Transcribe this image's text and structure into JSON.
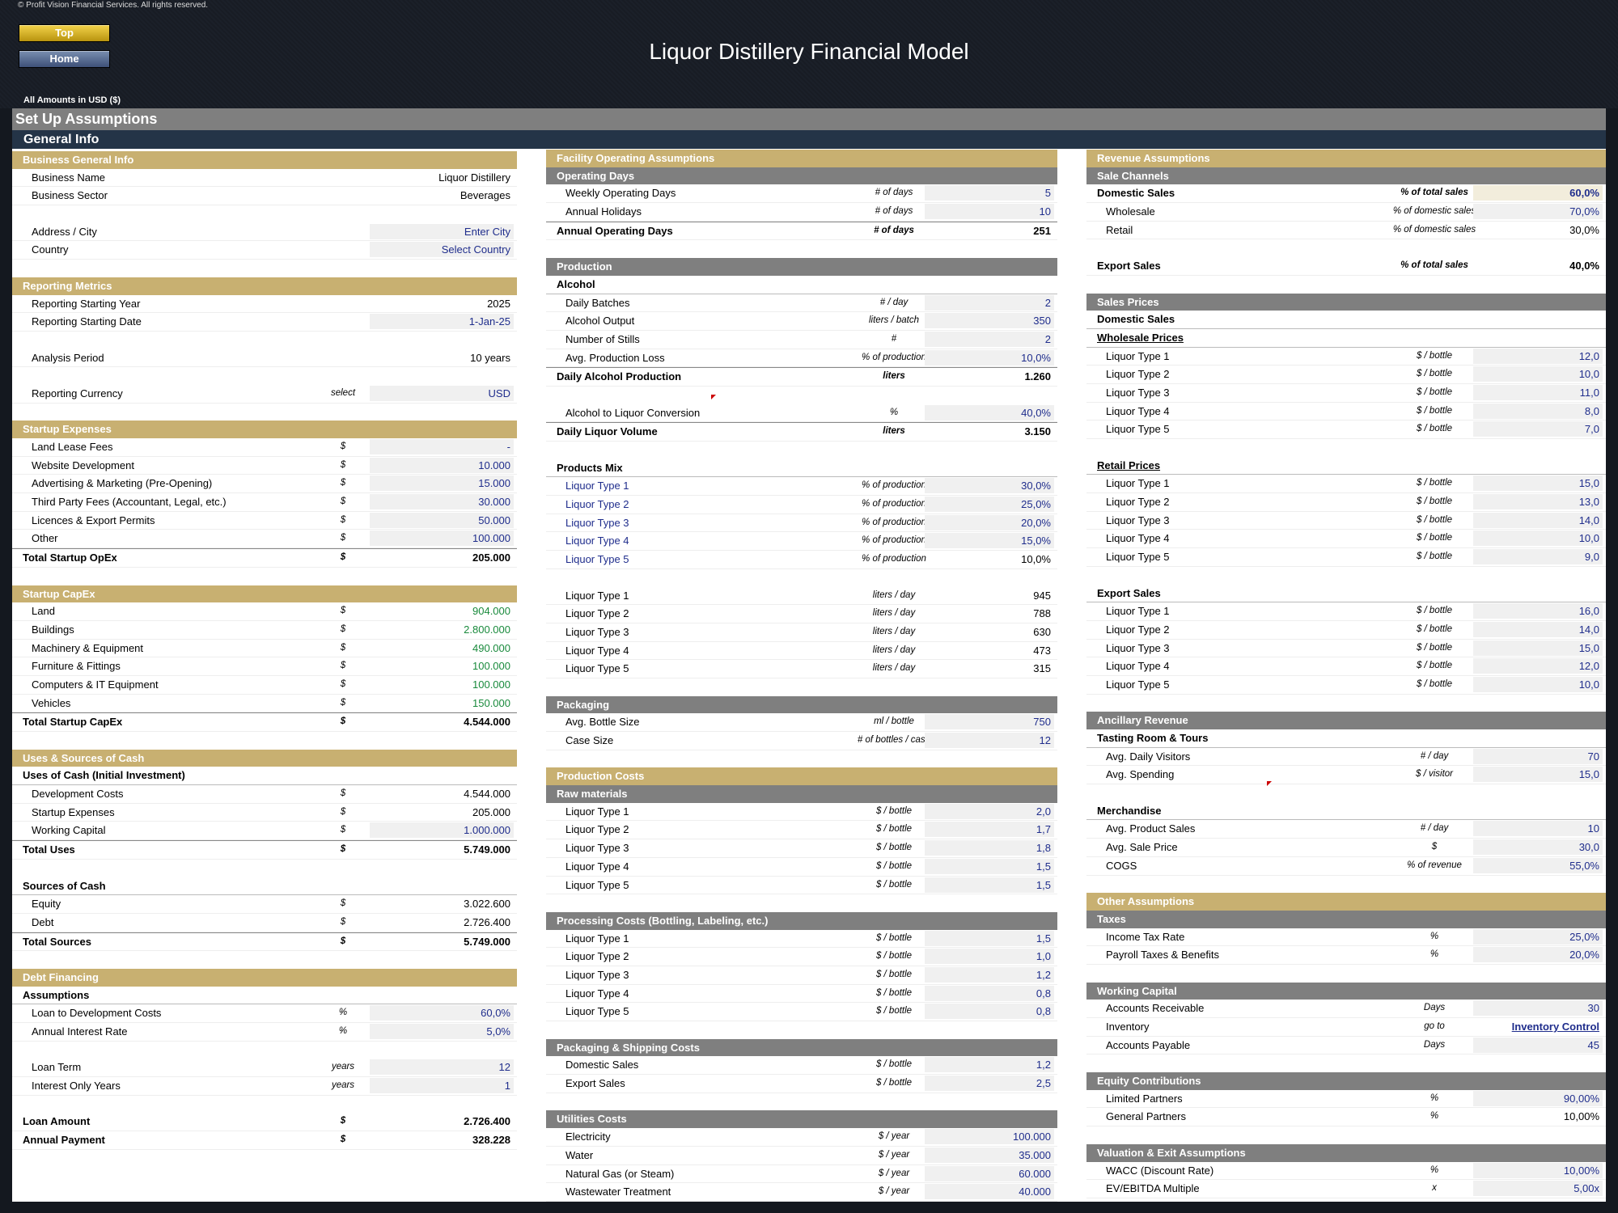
{
  "header": {
    "copyright": "© Profit Vision Financial Services. All rights reserved.",
    "top_button": "Top",
    "home_button": "Home",
    "title": "Liquor Distillery Financial Model",
    "amounts": "All Amounts in  USD ($)",
    "section": "Set Up Assumptions",
    "subsection": "General Info"
  },
  "col1": [
    {
      "t": "hdr",
      "label": "Business General Info"
    },
    {
      "t": "item",
      "label": "Business Name",
      "val": "Liquor Distillery",
      "style": "blk"
    },
    {
      "t": "item",
      "label": "Business Sector",
      "val": "Beverages",
      "style": "blk"
    },
    {
      "t": "sp"
    },
    {
      "t": "item",
      "label": "Address / City",
      "val": "Enter City",
      "style": "inp"
    },
    {
      "t": "item",
      "label": "Country",
      "val": "Select Country",
      "style": "inp"
    },
    {
      "t": "sp"
    },
    {
      "t": "hdr",
      "label": "Reporting Metrics"
    },
    {
      "t": "item",
      "label": "Reporting Starting Year",
      "val": "2025",
      "style": "blk"
    },
    {
      "t": "item",
      "label": "Reporting Starting Date",
      "val": "1-Jan-25",
      "style": "inp"
    },
    {
      "t": "sp"
    },
    {
      "t": "item",
      "label": "Analysis Period",
      "val": "10 years",
      "style": "blk"
    },
    {
      "t": "sp"
    },
    {
      "t": "item",
      "label": "Reporting Currency",
      "unit": "select",
      "val": "USD",
      "style": "inp"
    },
    {
      "t": "sp"
    },
    {
      "t": "hdr",
      "label": "Startup Expenses"
    },
    {
      "t": "item",
      "label": "Land Lease Fees",
      "unit": "$",
      "val": "-",
      "style": "inp"
    },
    {
      "t": "item",
      "label": "Website Development",
      "unit": "$",
      "val": "10.000",
      "style": "inp"
    },
    {
      "t": "item",
      "label": "Advertising & Marketing (Pre-Opening)",
      "unit": "$",
      "val": "15.000",
      "style": "inp"
    },
    {
      "t": "item",
      "label": "Third Party Fees (Accountant, Legal, etc.)",
      "unit": "$",
      "val": "30.000",
      "style": "inp"
    },
    {
      "t": "item",
      "label": "Licences & Export Permits",
      "unit": "$",
      "val": "50.000",
      "style": "inp"
    },
    {
      "t": "item",
      "label": "Other",
      "unit": "$",
      "val": "100.000",
      "style": "inp"
    },
    {
      "t": "total",
      "label": "Total Startup OpEx",
      "unit": "$",
      "val": "205.000"
    },
    {
      "t": "sp"
    },
    {
      "t": "hdr",
      "label": "Startup CapEx"
    },
    {
      "t": "item",
      "label": "Land",
      "unit": "$",
      "val": "904.000",
      "style": "green"
    },
    {
      "t": "item",
      "label": "Buildings",
      "unit": "$",
      "val": "2.800.000",
      "style": "green"
    },
    {
      "t": "item",
      "label": "Machinery & Equipment",
      "unit": "$",
      "val": "490.000",
      "style": "green"
    },
    {
      "t": "item",
      "label": "Furniture & Fittings",
      "unit": "$",
      "val": "100.000",
      "style": "green"
    },
    {
      "t": "item",
      "label": "Computers & IT Equipment",
      "unit": "$",
      "val": "100.000",
      "style": "green"
    },
    {
      "t": "item",
      "label": "Vehicles",
      "unit": "$",
      "val": "150.000",
      "style": "green"
    },
    {
      "t": "total",
      "label": "Total Startup CapEx",
      "unit": "$",
      "val": "4.544.000"
    },
    {
      "t": "sp"
    },
    {
      "t": "hdr",
      "label": "Uses & Sources of Cash"
    },
    {
      "t": "grp",
      "label": "Uses of Cash (Initial Investment)"
    },
    {
      "t": "item",
      "label": "Development Costs",
      "unit": "$",
      "val": "4.544.000",
      "style": "blk"
    },
    {
      "t": "item",
      "label": "Startup Expenses",
      "unit": "$",
      "val": "205.000",
      "style": "blk"
    },
    {
      "t": "item",
      "label": "Working Capital",
      "unit": "$",
      "val": "1.000.000",
      "style": "inp"
    },
    {
      "t": "total",
      "label": "Total Uses",
      "unit": "$",
      "val": "5.749.000"
    },
    {
      "t": "sp"
    },
    {
      "t": "grp",
      "label": "Sources of Cash"
    },
    {
      "t": "item",
      "label": "Equity",
      "unit": "$",
      "val": "3.022.600",
      "style": "blk"
    },
    {
      "t": "item",
      "label": "Debt",
      "unit": "$",
      "val": "2.726.400",
      "style": "blk"
    },
    {
      "t": "total",
      "label": "Total Sources",
      "unit": "$",
      "val": "5.749.000"
    },
    {
      "t": "sp"
    },
    {
      "t": "hdr",
      "label": "Debt Financing"
    },
    {
      "t": "grp",
      "label": "Assumptions"
    },
    {
      "t": "item",
      "label": "Loan to Development Costs",
      "unit": "%",
      "val": "60,0%",
      "style": "inp"
    },
    {
      "t": "item",
      "label": "Annual Interest Rate",
      "unit": "%",
      "val": "5,0%",
      "style": "inp"
    },
    {
      "t": "sp"
    },
    {
      "t": "item",
      "label": "Loan Term",
      "unit": "years",
      "val": "12",
      "style": "inp"
    },
    {
      "t": "item",
      "label": "Interest Only Years",
      "unit": "years",
      "val": "1",
      "style": "inp"
    },
    {
      "t": "sp"
    },
    {
      "t": "itembold",
      "label": "Loan Amount",
      "unit": "$",
      "val": "2.726.400"
    },
    {
      "t": "itembold",
      "label": "Annual Payment",
      "unit": "$",
      "val": "328.228"
    }
  ],
  "col2": [
    {
      "t": "hdr",
      "label": "Facility Operating Assumptions"
    },
    {
      "t": "sub",
      "label": "Operating Days"
    },
    {
      "t": "item",
      "label": "Weekly Operating Days",
      "unit": "# of days",
      "val": "5",
      "style": "inp"
    },
    {
      "t": "item",
      "label": "Annual Holidays",
      "unit": "# of days",
      "val": "10",
      "style": "inp"
    },
    {
      "t": "total",
      "label": "Annual Operating Days",
      "unit": "# of days",
      "val": "251"
    },
    {
      "t": "sp"
    },
    {
      "t": "sub",
      "label": "Production"
    },
    {
      "t": "grp",
      "label": "Alcohol"
    },
    {
      "t": "item",
      "label": "Daily Batches",
      "unit": "# / day",
      "val": "2",
      "style": "inp"
    },
    {
      "t": "item",
      "label": "Alcohol Output",
      "unit": "liters / batch",
      "val": "350",
      "style": "inp"
    },
    {
      "t": "item",
      "label": "Number of Stills",
      "unit": "#",
      "val": "2",
      "style": "inp"
    },
    {
      "t": "item",
      "label": "Avg. Production Loss",
      "unit": "% of production",
      "val": "10,0%",
      "style": "inp"
    },
    {
      "t": "total",
      "label": "Daily Alcohol Production",
      "unit": "liters",
      "val": "1.260"
    },
    {
      "t": "sp"
    },
    {
      "t": "item",
      "label": "Alcohol to Liquor Conversion",
      "unit": "%",
      "val": "40,0%",
      "style": "inp"
    },
    {
      "t": "total",
      "label": "Daily Liquor Volume",
      "unit": "liters",
      "val": "3.150"
    },
    {
      "t": "sp"
    },
    {
      "t": "grp",
      "label": "Products Mix"
    },
    {
      "t": "item",
      "label": "Liquor Type 1",
      "lblblue": true,
      "unit": "% of production",
      "val": "30,0%",
      "style": "inp"
    },
    {
      "t": "item",
      "label": "Liquor Type 2",
      "lblblue": true,
      "unit": "% of production",
      "val": "25,0%",
      "style": "inp"
    },
    {
      "t": "item",
      "label": "Liquor Type 3",
      "lblblue": true,
      "unit": "% of production",
      "val": "20,0%",
      "style": "inp"
    },
    {
      "t": "item",
      "label": "Liquor Type 4",
      "lblblue": true,
      "unit": "% of production",
      "val": "15,0%",
      "style": "inp"
    },
    {
      "t": "item",
      "label": "Liquor Type 5",
      "lblblue": true,
      "unit": "% of production",
      "val": "10,0%",
      "style": "blk"
    },
    {
      "t": "sp"
    },
    {
      "t": "item",
      "label": "Liquor Type 1",
      "unit": "liters / day",
      "val": "945",
      "style": "blk"
    },
    {
      "t": "item",
      "label": "Liquor Type 2",
      "unit": "liters / day",
      "val": "788",
      "style": "blk"
    },
    {
      "t": "item",
      "label": "Liquor Type 3",
      "unit": "liters / day",
      "val": "630",
      "style": "blk"
    },
    {
      "t": "item",
      "label": "Liquor Type 4",
      "unit": "liters / day",
      "val": "473",
      "style": "blk"
    },
    {
      "t": "item",
      "label": "Liquor Type 5",
      "unit": "liters / day",
      "val": "315",
      "style": "blk"
    },
    {
      "t": "sp"
    },
    {
      "t": "sub",
      "label": "Packaging"
    },
    {
      "t": "item",
      "label": "Avg. Bottle Size",
      "unit": "ml / bottle",
      "val": "750",
      "style": "inp"
    },
    {
      "t": "item",
      "label": "Case Size",
      "unit": "# of bottles / case",
      "val": "12",
      "style": "inp"
    },
    {
      "t": "sp"
    },
    {
      "t": "hdr",
      "label": "Production Costs"
    },
    {
      "t": "sub",
      "label": "Raw materials"
    },
    {
      "t": "item",
      "label": "Liquor Type 1",
      "unit": "$ / bottle",
      "val": "2,0",
      "style": "inp"
    },
    {
      "t": "item",
      "label": "Liquor Type 2",
      "unit": "$ / bottle",
      "val": "1,7",
      "style": "inp"
    },
    {
      "t": "item",
      "label": "Liquor Type 3",
      "unit": "$ / bottle",
      "val": "1,8",
      "style": "inp"
    },
    {
      "t": "item",
      "label": "Liquor Type 4",
      "unit": "$ / bottle",
      "val": "1,5",
      "style": "inp"
    },
    {
      "t": "item",
      "label": "Liquor Type 5",
      "unit": "$ / bottle",
      "val": "1,5",
      "style": "inp"
    },
    {
      "t": "sp"
    },
    {
      "t": "sub",
      "label": "Processing Costs (Bottling, Labeling, etc.)"
    },
    {
      "t": "item",
      "label": "Liquor Type 1",
      "unit": "$ / bottle",
      "val": "1,5",
      "style": "inp"
    },
    {
      "t": "item",
      "label": "Liquor Type 2",
      "unit": "$ / bottle",
      "val": "1,0",
      "style": "inp"
    },
    {
      "t": "item",
      "label": "Liquor Type 3",
      "unit": "$ / bottle",
      "val": "1,2",
      "style": "inp"
    },
    {
      "t": "item",
      "label": "Liquor Type 4",
      "unit": "$ / bottle",
      "val": "0,8",
      "style": "inp"
    },
    {
      "t": "item",
      "label": "Liquor Type 5",
      "unit": "$ / bottle",
      "val": "0,8",
      "style": "inp"
    },
    {
      "t": "sp"
    },
    {
      "t": "sub",
      "label": "Packaging & Shipping Costs"
    },
    {
      "t": "item",
      "label": "Domestic Sales",
      "unit": "$ / bottle",
      "val": "1,2",
      "style": "inp"
    },
    {
      "t": "item",
      "label": "Export Sales",
      "unit": "$ / bottle",
      "val": "2,5",
      "style": "inp"
    },
    {
      "t": "sp"
    },
    {
      "t": "sub",
      "label": "Utilities Costs"
    },
    {
      "t": "item",
      "label": "Electricity",
      "unit": "$ / year",
      "val": "100.000",
      "style": "inp"
    },
    {
      "t": "item",
      "label": "Water",
      "unit": "$ / year",
      "val": "35.000",
      "style": "inp"
    },
    {
      "t": "item",
      "label": "Natural Gas (or Steam)",
      "unit": "$ / year",
      "val": "60.000",
      "style": "inp"
    },
    {
      "t": "item",
      "label": "Wastewater Treatment",
      "unit": "$ / year",
      "val": "40.000",
      "style": "inp"
    }
  ],
  "col3": [
    {
      "t": "hdr",
      "label": "Revenue Assumptions"
    },
    {
      "t": "sub",
      "label": "Sale Channels"
    },
    {
      "t": "itembold",
      "label": "Domestic Sales",
      "unit": "% of total sales",
      "val": "60,0%",
      "style": "hl"
    },
    {
      "t": "item",
      "label": "Wholesale",
      "unit": "% of domestic sales",
      "val": "70,0%",
      "style": "inp"
    },
    {
      "t": "item",
      "label": "Retail",
      "unit": "% of domestic sales",
      "val": "30,0%",
      "style": "blk"
    },
    {
      "t": "sp"
    },
    {
      "t": "itembold",
      "label": "Export Sales",
      "unit": "% of total sales",
      "val": "40,0%",
      "style": "bold"
    },
    {
      "t": "sp"
    },
    {
      "t": "sub",
      "label": "Sales Prices"
    },
    {
      "t": "grp",
      "label": "Domestic Sales"
    },
    {
      "t": "grpu",
      "label": "Wholesale Prices"
    },
    {
      "t": "item",
      "label": "Liquor Type 1",
      "unit": "$ / bottle",
      "val": "12,0",
      "style": "inp"
    },
    {
      "t": "item",
      "label": "Liquor Type 2",
      "unit": "$ / bottle",
      "val": "10,0",
      "style": "inp"
    },
    {
      "t": "item",
      "label": "Liquor Type 3",
      "unit": "$ / bottle",
      "val": "11,0",
      "style": "inp"
    },
    {
      "t": "item",
      "label": "Liquor Type 4",
      "unit": "$ / bottle",
      "val": "8,0",
      "style": "inp"
    },
    {
      "t": "item",
      "label": "Liquor Type 5",
      "unit": "$ / bottle",
      "val": "7,0",
      "style": "inp"
    },
    {
      "t": "sp"
    },
    {
      "t": "grpu",
      "label": "Retail Prices"
    },
    {
      "t": "item",
      "label": "Liquor Type 1",
      "unit": "$ / bottle",
      "val": "15,0",
      "style": "inp"
    },
    {
      "t": "item",
      "label": "Liquor Type 2",
      "unit": "$ / bottle",
      "val": "13,0",
      "style": "inp"
    },
    {
      "t": "item",
      "label": "Liquor Type 3",
      "unit": "$ / bottle",
      "val": "14,0",
      "style": "inp"
    },
    {
      "t": "item",
      "label": "Liquor Type 4",
      "unit": "$ / bottle",
      "val": "10,0",
      "style": "inp"
    },
    {
      "t": "item",
      "label": "Liquor Type 5",
      "unit": "$ / bottle",
      "val": "9,0",
      "style": "inp"
    },
    {
      "t": "sp"
    },
    {
      "t": "grp",
      "label": "Export Sales"
    },
    {
      "t": "item",
      "label": "Liquor Type 1",
      "unit": "$ / bottle",
      "val": "16,0",
      "style": "inp"
    },
    {
      "t": "item",
      "label": "Liquor Type 2",
      "unit": "$ / bottle",
      "val": "14,0",
      "style": "inp"
    },
    {
      "t": "item",
      "label": "Liquor Type 3",
      "unit": "$ / bottle",
      "val": "15,0",
      "style": "inp"
    },
    {
      "t": "item",
      "label": "Liquor Type 4",
      "unit": "$ / bottle",
      "val": "12,0",
      "style": "inp"
    },
    {
      "t": "item",
      "label": "Liquor Type 5",
      "unit": "$ / bottle",
      "val": "10,0",
      "style": "inp"
    },
    {
      "t": "sp"
    },
    {
      "t": "sub",
      "label": "Ancillary Revenue"
    },
    {
      "t": "grp",
      "label": "Tasting Room & Tours"
    },
    {
      "t": "item",
      "label": "Avg. Daily Visitors",
      "unit": "# / day",
      "val": "70",
      "style": "inp"
    },
    {
      "t": "item",
      "label": "Avg. Spending",
      "unit": "$ / visitor",
      "val": "15,0",
      "style": "inp"
    },
    {
      "t": "sp"
    },
    {
      "t": "grp",
      "label": "Merchandise"
    },
    {
      "t": "item",
      "label": "Avg. Product Sales",
      "unit": "# / day",
      "val": "10",
      "style": "inp"
    },
    {
      "t": "item",
      "label": "Avg. Sale Price",
      "unit": "$",
      "val": "30,0",
      "style": "inp"
    },
    {
      "t": "item",
      "label": "COGS",
      "unit": "% of revenue",
      "val": "55,0%",
      "style": "inp"
    },
    {
      "t": "sp"
    },
    {
      "t": "hdr",
      "label": "Other Assumptions"
    },
    {
      "t": "sub",
      "label": "Taxes"
    },
    {
      "t": "item",
      "label": "Income Tax Rate",
      "unit": "%",
      "val": "25,0%",
      "style": "inp"
    },
    {
      "t": "item",
      "label": "Payroll Taxes & Benefits",
      "unit": "%",
      "val": "20,0%",
      "style": "inp"
    },
    {
      "t": "sp"
    },
    {
      "t": "sub",
      "label": "Working Capital"
    },
    {
      "t": "item",
      "label": "Accounts Receivable",
      "unit": "Days",
      "val": "30",
      "style": "inp"
    },
    {
      "t": "item",
      "label": "Inventory",
      "unit": "go to",
      "val": "Inventory Control",
      "style": "link"
    },
    {
      "t": "item",
      "label": "Accounts Payable",
      "unit": "Days",
      "val": "45",
      "style": "inp"
    },
    {
      "t": "sp"
    },
    {
      "t": "sub",
      "label": "Equity Contributions"
    },
    {
      "t": "item",
      "label": "Limited Partners",
      "unit": "%",
      "val": "90,00%",
      "style": "inp"
    },
    {
      "t": "item",
      "label": "General Partners",
      "unit": "%",
      "val": "10,00%",
      "style": "blk"
    },
    {
      "t": "sp"
    },
    {
      "t": "sub",
      "label": "Valuation & Exit Assumptions"
    },
    {
      "t": "item",
      "label": "WACC (Discount Rate)",
      "unit": "%",
      "val": "10,00%",
      "style": "inp"
    },
    {
      "t": "item",
      "label": "EV/EBITDA Multiple",
      "unit": "x",
      "val": "5,00x",
      "style": "inp"
    }
  ]
}
